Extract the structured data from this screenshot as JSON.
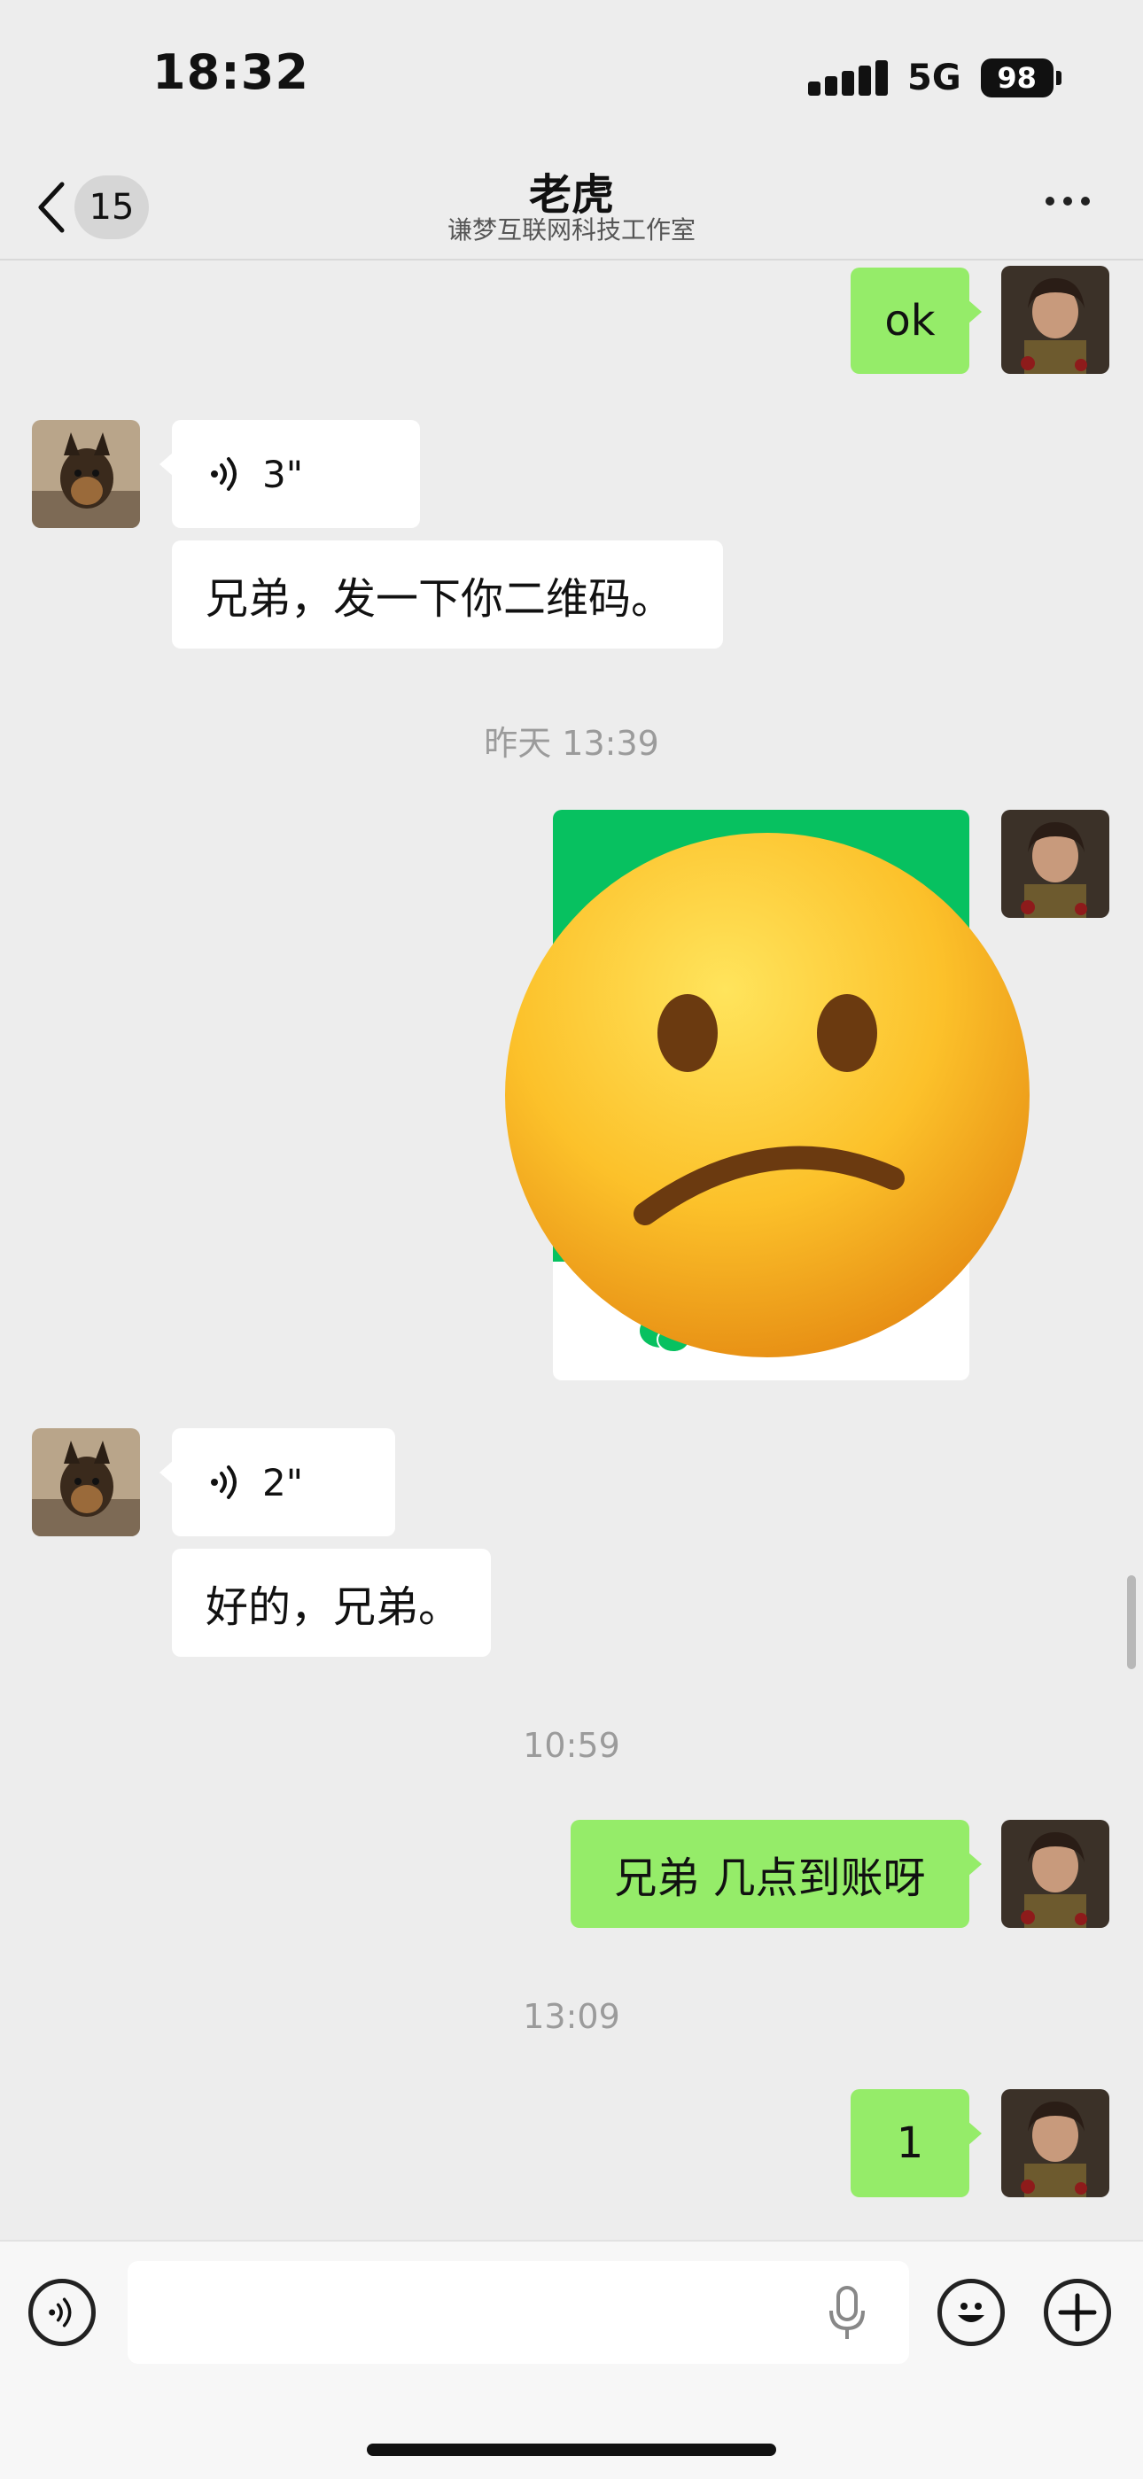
{
  "status": {
    "time": "18:32",
    "network": "5G",
    "battery": "98"
  },
  "nav": {
    "unread_count": "15",
    "title": "老虎",
    "subtitle": "谦梦互联网科技工作室"
  },
  "messages": {
    "m1": "ok",
    "voice1": "3\"",
    "m2": "兄弟，发一下你二维码。",
    "time1": "昨天 13:39",
    "voice2": "2\"",
    "m3": "好的，兄弟。",
    "time2": "10:59",
    "m4": "兄弟 几点到账呀",
    "time3": "13:09",
    "m5": "1"
  },
  "colors": {
    "incoming_bubble": "#ffffff",
    "outgoing_bubble": "#95ec69",
    "background": "#ededed",
    "card_green": "#07c160"
  },
  "icons": [
    "chevron-left-icon",
    "more-dots-icon",
    "voice-wave-icon",
    "microphone-icon",
    "emoji-face-icon",
    "plus-icon",
    "confused-face-emoji"
  ]
}
